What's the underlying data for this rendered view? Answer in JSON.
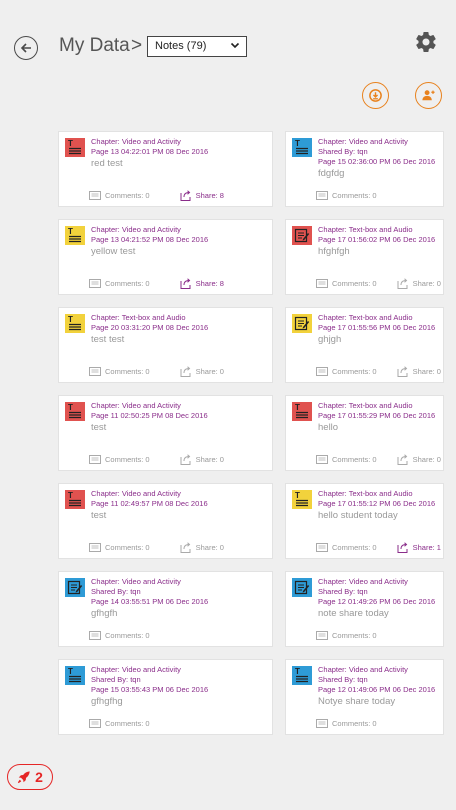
{
  "header": {
    "title": "My Data",
    "separator": ">",
    "filter_value": "Notes (79)"
  },
  "colors": {
    "accent_orange": "#e8821e",
    "meta_purple": "#8a2d8a",
    "text_icon_red": "#e0524f",
    "text_icon_blue": "#2e9bd6",
    "text_icon_yellow": "#f2d23c",
    "notif_red": "#e52626"
  },
  "notes": [
    {
      "icon": "text-note-icon",
      "color": "red",
      "line1": "Chapter: Video and Activity",
      "line2": "Page 13  04:22:01 PM   08 Dec 2016",
      "text": "red test",
      "comments": "Comments: 0",
      "share": "Share: 8",
      "shared": true
    },
    {
      "icon": "text-note-icon",
      "color": "blue",
      "line1": "Chapter: Video and Activity",
      "line2": "Shared By: tqn",
      "line3": "Page 15  02:36:00 PM   06 Dec 2016",
      "text": "fdgfdg",
      "comments": "Comments: 0",
      "share": "",
      "shared": false
    },
    {
      "icon": "text-note-icon",
      "color": "yellow",
      "line1": "Chapter: Video and Activity",
      "line2": "Page 13  04:21:52 PM   08 Dec 2016",
      "text": "yellow test",
      "comments": "Comments: 0",
      "share": "Share: 8",
      "shared": true
    },
    {
      "icon": "edit-note-icon",
      "color": "red",
      "line1": "Chapter: Text-box and Audio",
      "line2": "Page 17  01:56:02 PM   06 Dec 2016",
      "text": "hfghfgh",
      "comments": "Comments: 0",
      "share": "Share: 0",
      "shared": false
    },
    {
      "icon": "text-note-icon",
      "color": "yellow",
      "line1": "Chapter: Text-box and Audio",
      "line2": "Page 20  03:31:20 PM   08 Dec 2016",
      "text": "test test",
      "comments": "Comments: 0",
      "share": "Share: 0",
      "shared": false
    },
    {
      "icon": "edit-note-icon",
      "color": "yellow",
      "line1": "Chapter: Text-box and Audio",
      "line2": "Page 17  01:55:56 PM   06 Dec 2016",
      "text": "ghjgh",
      "comments": "Comments: 0",
      "share": "Share: 0",
      "shared": false
    },
    {
      "icon": "text-note-icon",
      "color": "red",
      "line1": "Chapter: Video and Activity",
      "line2": "Page 11  02:50:25 PM   08 Dec 2016",
      "text": "test",
      "comments": "Comments: 0",
      "share": "Share: 0",
      "shared": false
    },
    {
      "icon": "text-note-icon",
      "color": "red",
      "line1": "Chapter: Text-box and Audio",
      "line2": "Page 17  01:55:29 PM   06 Dec 2016",
      "text": "hello",
      "comments": "Comments: 0",
      "share": "Share: 0",
      "shared": false
    },
    {
      "icon": "text-note-icon",
      "color": "red",
      "line1": "Chapter: Video and Activity",
      "line2": "Page 11  02:49:57 PM   08 Dec 2016",
      "text": "test",
      "comments": "Comments: 0",
      "share": "Share: 0",
      "shared": false
    },
    {
      "icon": "text-note-icon",
      "color": "yellow",
      "line1": "Chapter: Text-box and Audio",
      "line2": "Page 17  01:55:12 PM   06 Dec 2016",
      "text": "hello student today",
      "comments": "Comments: 0",
      "share": "Share: 1",
      "shared": true
    },
    {
      "icon": "edit-note-icon",
      "color": "blue",
      "line1": "Chapter: Video and Activity",
      "line2": "Shared By: tqn",
      "line3": "Page 14  03:55:51 PM   06 Dec 2016",
      "text": "gfhgfh",
      "comments": "Comments: 0",
      "share": "",
      "shared": false
    },
    {
      "icon": "edit-note-icon",
      "color": "blue",
      "line1": "Chapter: Video and Activity",
      "line2": "Shared By: tqn",
      "line3": "Page 12  01:49:26 PM   06 Dec 2016",
      "text": "note share today",
      "comments": "Comments: 0",
      "share": "",
      "shared": false
    },
    {
      "icon": "text-note-icon",
      "color": "blue",
      "line1": "Chapter: Video and Activity",
      "line2": "Shared By: tqn",
      "line3": "Page 15  03:55:43 PM   06 Dec 2016",
      "text": "gfhgfhg",
      "comments": "Comments: 0",
      "share": "",
      "shared": false
    },
    {
      "icon": "text-note-icon",
      "color": "blue",
      "line1": "Chapter: Video and Activity",
      "line2": "Shared By: tqn",
      "line3": "Page 12  01:49:06 PM   06 Dec 2016",
      "text": "Notye share today",
      "comments": "Comments: 0",
      "share": "",
      "shared": false
    }
  ],
  "notification": {
    "count": "2"
  }
}
